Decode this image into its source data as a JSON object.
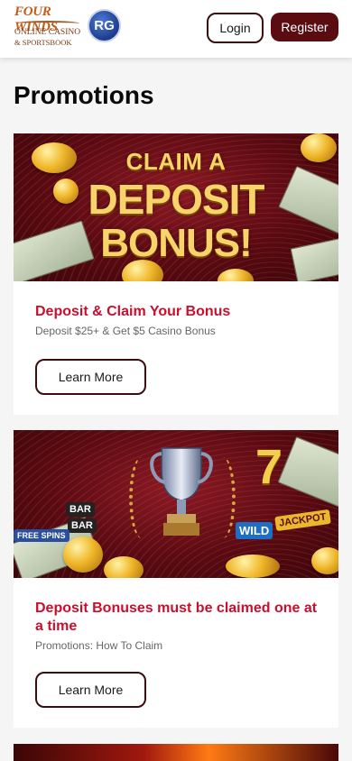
{
  "header": {
    "logo_line1": "FOUR WINDS",
    "logo_line2": "ONLINE CASINO",
    "logo_line3": "& SPORTSBOOK",
    "rg_badge": "RG",
    "login_label": "Login",
    "register_label": "Register"
  },
  "page": {
    "title": "Promotions"
  },
  "promotions": [
    {
      "banner": {
        "line1": "CLAIM A",
        "line2": "DEPOSIT",
        "line3": "BONUS!"
      },
      "title": "Deposit & Claim Your Bonus",
      "subtitle": "Deposit $25+ & Get $5 Casino Bonus",
      "button_label": "Learn More"
    },
    {
      "banner": {
        "tag1": "BAR",
        "tag2": "BAR",
        "tag3": "WILD",
        "tag4": "JACKPOT",
        "tag5": "FREE SPINS",
        "tag6": "7"
      },
      "title": "Deposit Bonuses must be claimed one at a time",
      "subtitle": "Promotions: How To Claim",
      "button_label": "Learn More"
    }
  ],
  "colors": {
    "accent_red": "#c8102e",
    "brand_maroon": "#5a0c10",
    "gold": "#f7d36a"
  }
}
